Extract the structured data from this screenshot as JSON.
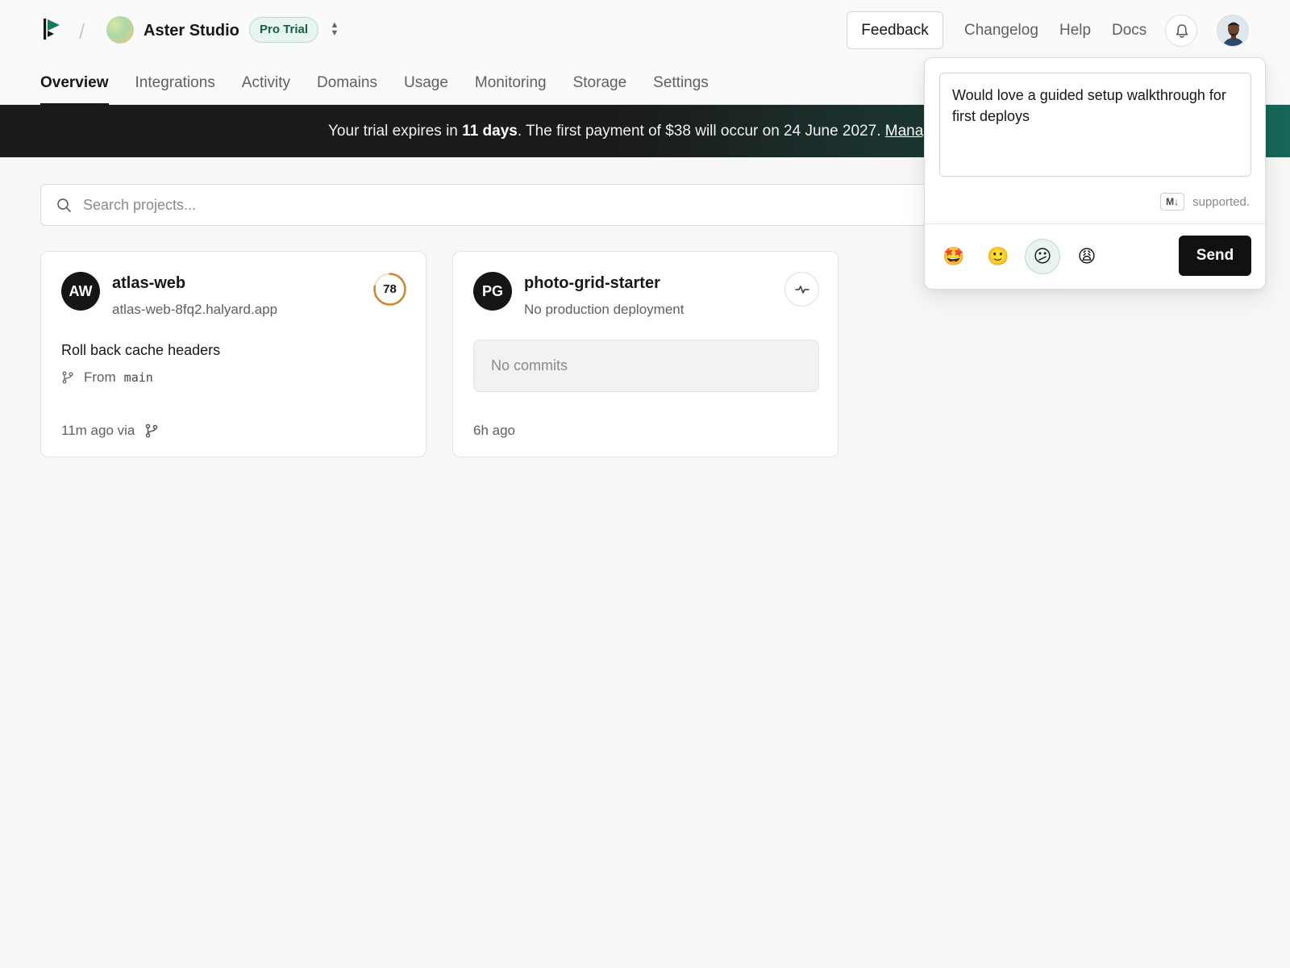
{
  "header": {
    "team_name": "Aster Studio",
    "plan_badge": "Pro Trial",
    "feedback_label": "Feedback",
    "links": [
      "Changelog",
      "Help",
      "Docs"
    ],
    "icons": {
      "logo": "logo-flag-icon",
      "switch": "chevron-updown-icon",
      "bell": "bell-icon",
      "avatar": "user-avatar"
    }
  },
  "tabs": [
    "Overview",
    "Integrations",
    "Activity",
    "Domains",
    "Usage",
    "Monitoring",
    "Storage",
    "Settings"
  ],
  "active_tab": "Overview",
  "banner": {
    "prefix": "Your trial expires in ",
    "days": "11 days",
    "middle": ". The first payment of $38 will occur on 24 June 2027. ",
    "link": "Manag"
  },
  "search": {
    "placeholder": "Search projects..."
  },
  "projects": [
    {
      "initials": "AW",
      "name": "atlas-web",
      "domain": "atlas-web-8fq2.halyard.app",
      "score": "78",
      "score_fraction": 0.78,
      "commit_message": "Roll back cache headers",
      "from_label": "From",
      "branch": "main",
      "footer": "11m ago via"
    },
    {
      "initials": "PG",
      "name": "photo-grid-starter",
      "domain": "No production deployment",
      "empty_label": "No commits",
      "footer": "6h ago"
    }
  ],
  "feedback_popover": {
    "text": "Would love a guided setup walkthrough for first deploys",
    "markdown_badge": "M↓",
    "markdown_note": "supported.",
    "emojis": [
      "🤩",
      "🙂",
      "😕",
      "😩"
    ],
    "selected_emoji_index": 2,
    "send_label": "Send"
  },
  "colors": {
    "accent": "#15603f",
    "score_ring": "#c98a2b",
    "banner_dark": "#1b1b1b",
    "banner_teal": "#17685a"
  }
}
